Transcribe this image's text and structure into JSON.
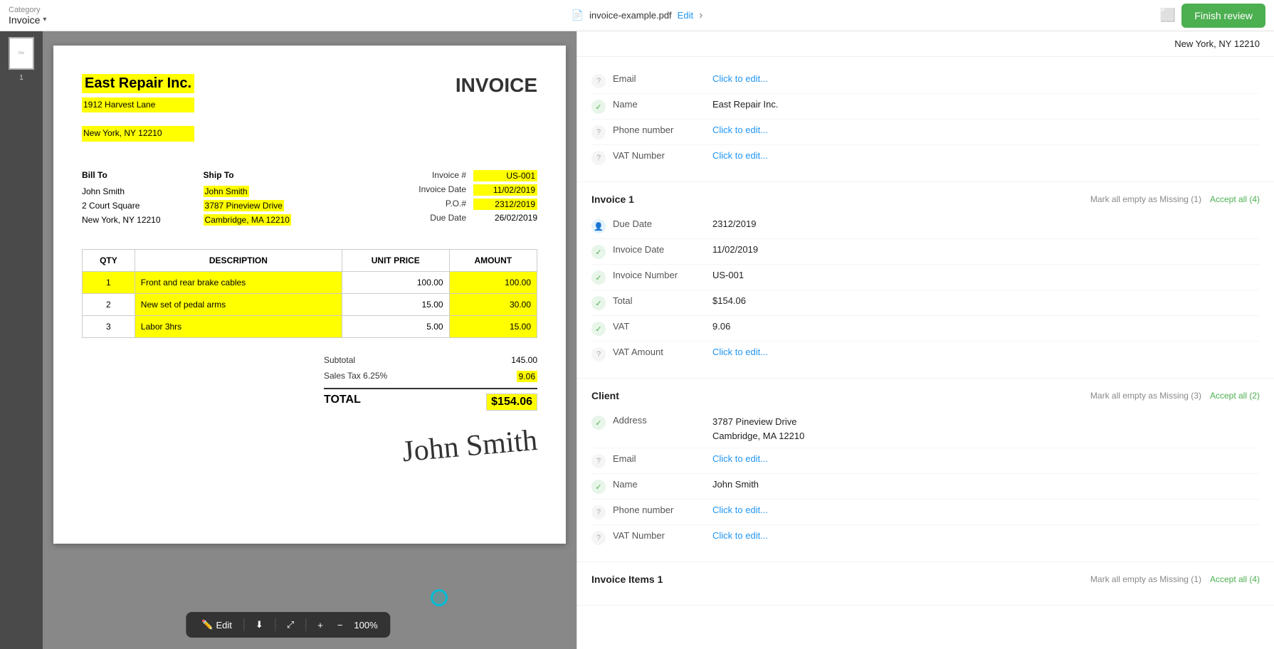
{
  "topbar": {
    "category_label": "Category",
    "category_title": "Invoice",
    "filename": "invoice-example.pdf",
    "edit_label": "Edit",
    "finish_label": "Finish review"
  },
  "toolbar": {
    "edit_label": "Edit",
    "zoom": "100%",
    "plus": "+",
    "minus": "−"
  },
  "invoice": {
    "company_name": "East Repair Inc.",
    "address_line1": "1912 Harvest Lane",
    "address_line2": "New York, NY 12210",
    "title": "INVOICE",
    "bill_to_label": "Bill To",
    "ship_to_label": "Ship To",
    "bill_name": "John Smith",
    "bill_addr1": "2 Court Square",
    "bill_addr2": "New York, NY 12210",
    "ship_name": "John Smith",
    "ship_addr1": "3787 Pineview Drive",
    "ship_addr2": "Cambridge, MA 12210",
    "invoice_num_label": "Invoice #",
    "invoice_num_value": "US-001",
    "invoice_date_label": "Invoice Date",
    "invoice_date_value": "11/02/2019",
    "po_label": "P.O.#",
    "po_value": "2312/2019",
    "due_date_label": "Due Date",
    "due_date_value": "26/02/2019",
    "table_headers": [
      "QTY",
      "DESCRIPTION",
      "UNIT PRICE",
      "AMOUNT"
    ],
    "table_rows": [
      {
        "qty": "1",
        "desc": "Front and rear brake cables",
        "unit": "100.00",
        "amount": "100.00"
      },
      {
        "qty": "2",
        "desc": "New set of pedal arms",
        "unit": "15.00",
        "amount": "30.00"
      },
      {
        "qty": "3",
        "desc": "Labor 3hrs",
        "unit": "5.00",
        "amount": "15.00"
      }
    ],
    "subtotal_label": "Subtotal",
    "subtotal_value": "145.00",
    "tax_label": "Sales Tax 6.25%",
    "tax_value": "9.06",
    "total_label": "TOTAL",
    "total_value": "$154.06",
    "signature": "John Smith"
  },
  "right_panel": {
    "top_address": "New York, NY 12210",
    "vendor_section": {
      "title": "Invoice 1",
      "mark_missing": "Mark all empty as Missing (1)",
      "accept_all": "Accept all (4)",
      "fields": [
        {
          "status": "question",
          "label": "Email",
          "value": "Click to edit...",
          "clickable": true
        },
        {
          "status": "check",
          "label": "Name",
          "value": "East Repair Inc.",
          "clickable": false
        },
        {
          "status": "question",
          "label": "Phone number",
          "value": "Click to edit...",
          "clickable": true
        },
        {
          "status": "question",
          "label": "VAT Number",
          "value": "Click to edit...",
          "clickable": true
        }
      ]
    },
    "invoice_section": {
      "title": "Invoice 1",
      "mark_missing": "Mark all empty as Missing (1)",
      "accept_all": "Accept all (4)",
      "fields": [
        {
          "status": "person",
          "label": "Due Date",
          "value": "2312/2019",
          "clickable": false
        },
        {
          "status": "check",
          "label": "Invoice Date",
          "value": "11/02/2019",
          "clickable": false
        },
        {
          "status": "check",
          "label": "Invoice Number",
          "value": "US-001",
          "clickable": false
        },
        {
          "status": "check",
          "label": "Total",
          "value": "$154.06",
          "clickable": false
        },
        {
          "status": "check",
          "label": "VAT",
          "value": "9.06",
          "clickable": false
        },
        {
          "status": "question",
          "label": "VAT Amount",
          "value": "Click to edit...",
          "clickable": true
        }
      ]
    },
    "client_section": {
      "title": "Client",
      "mark_missing": "Mark all empty as Missing (3)",
      "accept_all": "Accept all (2)",
      "fields": [
        {
          "status": "check",
          "label": "Address",
          "value": "3787 Pineview Drive\nCambridge, MA 12210",
          "multiline": true,
          "clickable": false
        },
        {
          "status": "question",
          "label": "Email",
          "value": "Click to edit...",
          "clickable": true
        },
        {
          "status": "check",
          "label": "Name",
          "value": "John Smith",
          "clickable": false
        },
        {
          "status": "question",
          "label": "Phone number",
          "value": "Click to edit...",
          "clickable": true
        },
        {
          "status": "question",
          "label": "VAT Number",
          "value": "Click to edit...",
          "clickable": true
        }
      ]
    },
    "invoice_items_section": {
      "title": "Invoice Items 1",
      "mark_missing": "Mark all empty as Missing (1)",
      "accept_all": "Accept all (4)"
    }
  }
}
